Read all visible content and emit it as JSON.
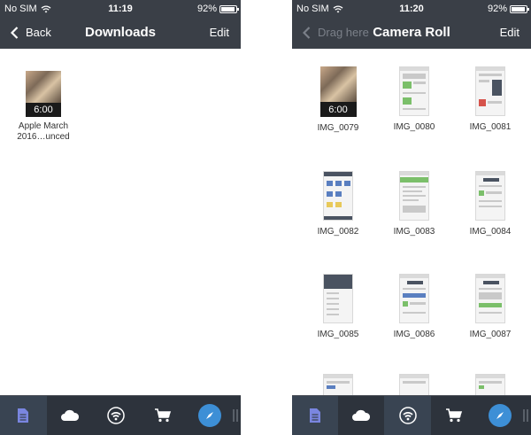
{
  "left": {
    "status": {
      "carrier": "No SIM",
      "time": "11:19",
      "battery": "92%",
      "battery_level": 0.92
    },
    "nav": {
      "back_label": "Back",
      "title": "Downloads",
      "edit_label": "Edit"
    },
    "files": [
      {
        "name_line1": "Apple March",
        "name_line2": "2016…unced",
        "duration": "6:00"
      }
    ]
  },
  "right": {
    "status": {
      "carrier": "No SIM",
      "time": "11:20",
      "battery": "92%",
      "battery_level": 0.92
    },
    "nav": {
      "back_label": "Drag here",
      "title": "Camera Roll",
      "edit_label": "Edit"
    },
    "photos": [
      {
        "label": "IMG_0079",
        "duration": "6:00"
      },
      {
        "label": "IMG_0080"
      },
      {
        "label": "IMG_0081"
      },
      {
        "label": "IMG_0082"
      },
      {
        "label": "IMG_0083"
      },
      {
        "label": "IMG_0084"
      },
      {
        "label": "IMG_0085"
      },
      {
        "label": "IMG_0086"
      },
      {
        "label": "IMG_0087"
      }
    ]
  },
  "tabs": [
    {
      "icon": "document-icon",
      "active": true
    },
    {
      "icon": "cloud-icon"
    },
    {
      "icon": "wifi-icon"
    },
    {
      "icon": "cart-icon"
    },
    {
      "icon": "compass-icon"
    }
  ],
  "colors": {
    "bar": "#3a3f47",
    "tabbar": "#2d333c",
    "active_tab": "#7a86e0",
    "compass": "#3d8fd6"
  }
}
